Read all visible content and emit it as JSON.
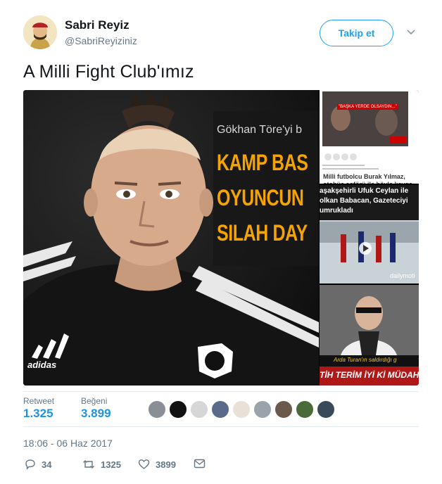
{
  "author": {
    "name": "Sabri Reyiz",
    "handle": "@SabriReyiziniz",
    "avatar_icon": "avatar-icon"
  },
  "follow_label": "Takip et",
  "tweet_text": "A Milli Fight Club'ımız",
  "media": {
    "main": {
      "intro": "Gökhan Töre'yi b",
      "headline": [
        "KAMP BAS",
        "OYUNCUN",
        "SILAH DAY"
      ]
    },
    "side1": {
      "thumb_caption": "\"BAŞKA YERDE OLSAYDIN...\"",
      "headline": "Milli futbolcu Burak Yılmaz, otobüs şoförü ile böyle kavga"
    },
    "side2": {
      "headline": [
        "aşakşehirli Ufuk Ceylan ile",
        "olkan Babacan, Gazeteciyi",
        "umrukladı"
      ],
      "watermark": "dailymoti"
    },
    "side3": {
      "caption": "Arda Turan'ın saldırdığı g",
      "banner": "TİH TERİM İYİ Kİ MÜDAHALE"
    }
  },
  "stats": {
    "retweet_label": "Retweet",
    "retweet_count": "1.325",
    "like_label": "Beğeni",
    "like_count": "3.899"
  },
  "timestamp": "18:06 - 06 Haz 2017",
  "actions": {
    "reply_count": "34",
    "retweet_count": "1325",
    "like_count": "3899"
  },
  "colors": {
    "accent": "#1da1f2",
    "link": "#1b95e0",
    "muted": "#657786",
    "banner": "#f5a300"
  }
}
